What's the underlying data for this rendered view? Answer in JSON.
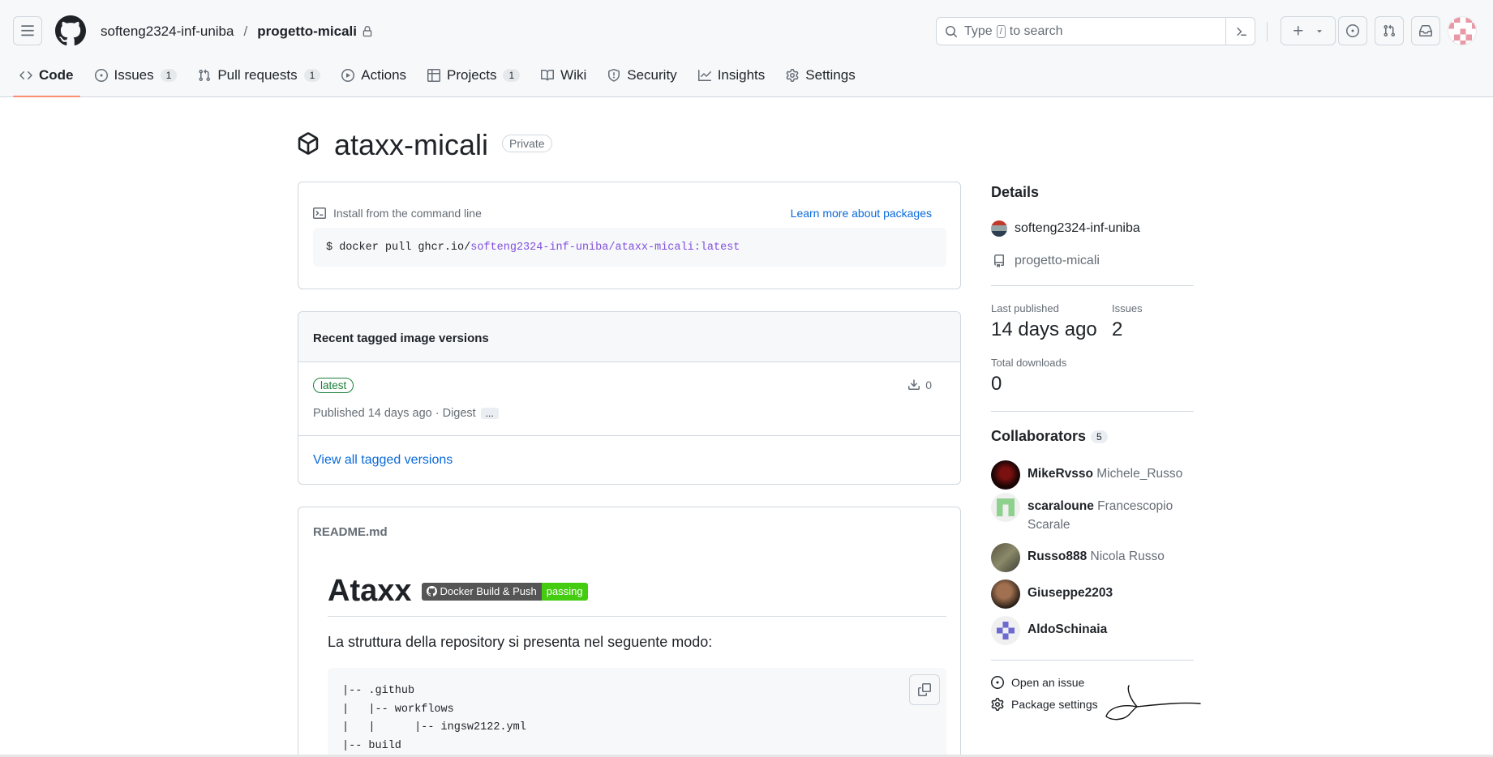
{
  "header": {
    "owner": "softeng2324-inf-uniba",
    "separator": "/",
    "repo": "progetto-micali",
    "search_prefix": "Type",
    "search_key": "/",
    "search_suffix": "to search"
  },
  "tabs": [
    {
      "label": "Code",
      "count": "",
      "icon": "code-icon"
    },
    {
      "label": "Issues",
      "count": "1",
      "icon": "issue-icon"
    },
    {
      "label": "Pull requests",
      "count": "1",
      "icon": "pull-request-icon"
    },
    {
      "label": "Actions",
      "count": "",
      "icon": "play-icon"
    },
    {
      "label": "Projects",
      "count": "1",
      "icon": "table-icon"
    },
    {
      "label": "Wiki",
      "count": "",
      "icon": "book-icon"
    },
    {
      "label": "Security",
      "count": "",
      "icon": "shield-icon"
    },
    {
      "label": "Insights",
      "count": "",
      "icon": "graph-icon"
    },
    {
      "label": "Settings",
      "count": "",
      "icon": "gear-icon"
    }
  ],
  "package": {
    "name": "ataxx-micali",
    "visibility": "Private"
  },
  "install": {
    "heading": "Install from the command line",
    "learn_more": "Learn more about packages",
    "cmd_prefix": "$ docker pull ghcr.io/",
    "cmd_owner": "softeng2324-inf-uniba",
    "cmd_slash": "/",
    "cmd_image": "ataxx-micali:latest"
  },
  "tagged": {
    "heading": "Recent tagged image versions",
    "tag": "latest",
    "downloads": "0",
    "published": "Published 14 days ago · Digest",
    "more": "...",
    "view_all": "View all tagged versions"
  },
  "readme": {
    "filename": "README.md",
    "title": "Ataxx",
    "badge_left": "Docker Build & Push",
    "badge_right": "passing",
    "paragraph": "La struttura della repository si presenta nel seguente modo:",
    "code": "|-- .github\n|   |-- workflows\n|   |      |-- ingsw2122.yml\n|-- build"
  },
  "details": {
    "heading": "Details",
    "owner": "softeng2324-inf-uniba",
    "repo": "progetto-micali",
    "last_published_label": "Last published",
    "last_published": "14 days ago",
    "issues_label": "Issues",
    "issues": "2",
    "downloads_label": "Total downloads",
    "downloads": "0"
  },
  "collaborators": {
    "heading": "Collaborators",
    "count": "5",
    "list": [
      {
        "login": "MikeRvsso",
        "name": "Michele_Russo"
      },
      {
        "login": "scaraloune",
        "name": "Francescopio Scarale"
      },
      {
        "login": "Russo888",
        "name": "Nicola Russo"
      },
      {
        "login": "Giuseppe2203",
        "name": ""
      },
      {
        "login": "AldoSchinaia",
        "name": ""
      }
    ]
  },
  "actions": {
    "open_issue": "Open an issue",
    "package_settings": "Package settings"
  },
  "colors": {
    "accent_link": "#0969da",
    "active_tab_underline": "#fd8c73",
    "tag_green": "#1a7f37",
    "badge_pass": "#44cc11"
  }
}
